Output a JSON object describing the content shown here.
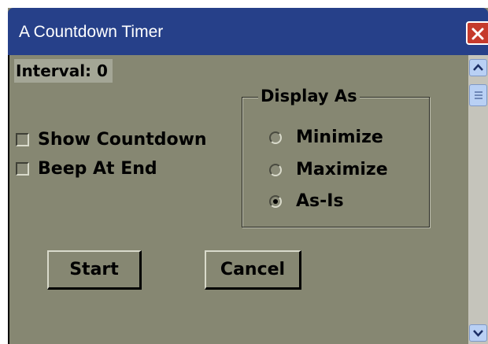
{
  "window": {
    "title": "A Countdown Timer",
    "close_icon": "close-icon"
  },
  "interval": {
    "label": "Interval: 0"
  },
  "options": [
    {
      "label": "Show Countdown",
      "checked": false
    },
    {
      "label": "Beep At End",
      "checked": false
    }
  ],
  "display_as": {
    "legend": "Display As",
    "choices": [
      {
        "label": "Minimize",
        "selected": false
      },
      {
        "label": "Maximize",
        "selected": false
      },
      {
        "label": "As-Is",
        "selected": true
      }
    ]
  },
  "buttons": {
    "start": "Start",
    "cancel": "Cancel"
  },
  "scrollbar": {
    "up_icon": "chevron-up-icon",
    "down_icon": "chevron-down-icon"
  },
  "colors": {
    "titlebar": "#264089",
    "window_bg": "#868772",
    "close_button": "#c53a2c",
    "scrollbar_accent": "#b9d0f4"
  }
}
